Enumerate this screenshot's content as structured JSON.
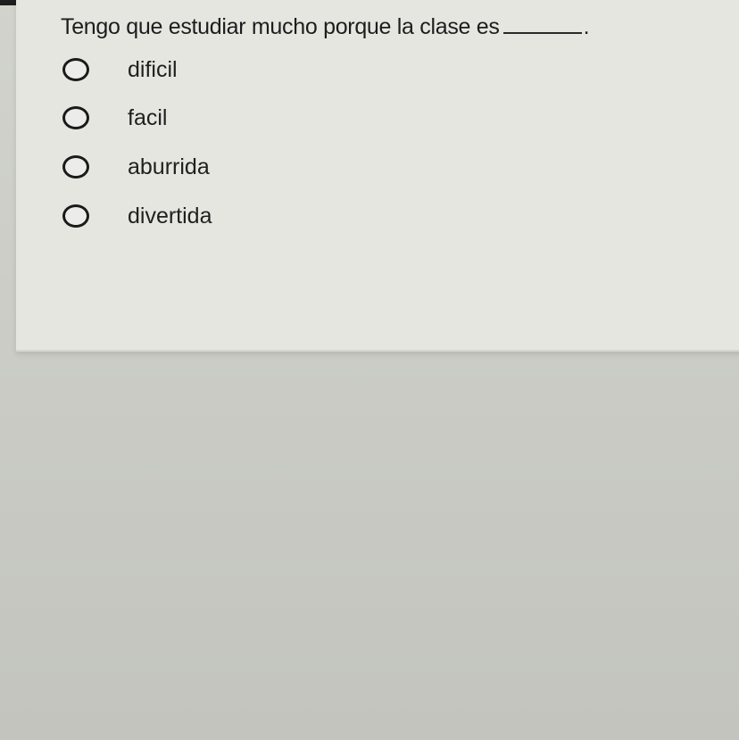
{
  "question": {
    "text": "Tengo que estudiar mucho porque la clase es",
    "period": "."
  },
  "options": [
    {
      "label": "dificil"
    },
    {
      "label": "facil"
    },
    {
      "label": "aburrida"
    },
    {
      "label": "divertida"
    }
  ]
}
